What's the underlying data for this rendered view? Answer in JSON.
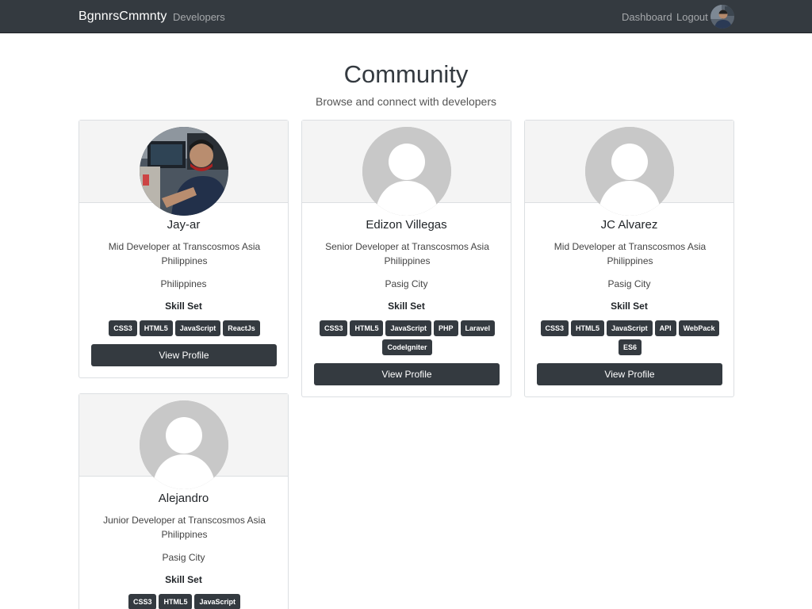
{
  "navbar": {
    "brand": "BgnnrsCmmnty",
    "developers_link": "Developers",
    "dashboard_link": "Dashboard",
    "logout_link": "Logout"
  },
  "header": {
    "title": "Community",
    "subtitle": "Browse and connect with developers"
  },
  "skill_label": "Skill Set",
  "view_profile_label": "View Profile",
  "profiles": [
    {
      "name": "Jay-ar",
      "role": "Mid Developer at Transcosmos Asia Philippines",
      "location": "Philippines",
      "skills": [
        "CSS3",
        "HTML5",
        "JavaScript",
        "ReactJs"
      ],
      "avatar": "photo"
    },
    {
      "name": "Edizon Villegas",
      "role": "Senior Developer at Transcosmos Asia Philippines",
      "location": "Pasig City",
      "skills": [
        "CSS3",
        "HTML5",
        "JavaScript",
        "PHP",
        "Laravel",
        "CodeIgniter"
      ],
      "avatar": "default"
    },
    {
      "name": "JC Alvarez",
      "role": "Mid Developer at Transcosmos Asia Philippines",
      "location": "Pasig City",
      "skills": [
        "CSS3",
        "HTML5",
        "JavaScript",
        "API",
        "WebPack",
        "ES6"
      ],
      "avatar": "default"
    },
    {
      "name": "Alejandro",
      "role": "Junior Developer at Transcosmos Asia Philippines",
      "location": "Pasig City",
      "skills": [
        "CSS3",
        "HTML5",
        "JavaScript"
      ],
      "avatar": "default"
    }
  ],
  "colors": {
    "navbar": "#343a40",
    "badge": "#343a40",
    "button": "#343a40",
    "card_header": "#f4f4f4",
    "avatar_placeholder": "#c8c8c8"
  }
}
